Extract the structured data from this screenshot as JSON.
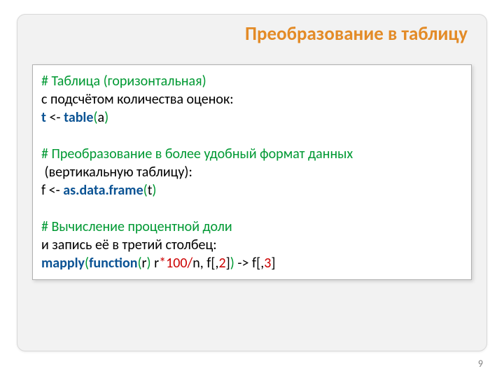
{
  "title": "Преобразование в таблицу",
  "code": {
    "c1": "# Таблица (горизонтальная)",
    "c2": "с подсчётом количества оценок:",
    "c3_t": "t",
    "c3_arrow": " <- ",
    "c3_table": "table",
    "c3_paren_open": "(",
    "c3_a": "a",
    "c3_paren_close": ")",
    "c4": "# Преобразование в более удобный формат данных",
    "c5": " (вертикальную таблицу):",
    "c6_f": "f",
    "c6_arrow": " <- ",
    "c6_fn": "as.data.frame",
    "c6_paren_open": "(",
    "c6_t": "t",
    "c6_paren_close": ")",
    "c7": "# Вычисление процентной доли",
    "c8": "и запись её в третий столбец:",
    "c9_mapply": "mapply",
    "c9_po1": "(",
    "c9_function": "function",
    "c9_po2": "(",
    "c9_r1": "r",
    "c9_pc2": ")",
    "c9_sp1": " ",
    "c9_r2": "r",
    "c9_star": "*",
    "c9_100": "100",
    "c9_slash": "/",
    "c9_n": "n",
    "c9_comma1": ", ",
    "c9_f1": "f",
    "c9_br1": "[,",
    "c9_2": "2",
    "c9_br1c": "]",
    "c9_pc1": ")",
    "c9_arrow": " -> ",
    "c9_f2": "f",
    "c9_br2": "[,",
    "c9_3": "3",
    "c9_br2c": "]"
  },
  "page_number": "9"
}
